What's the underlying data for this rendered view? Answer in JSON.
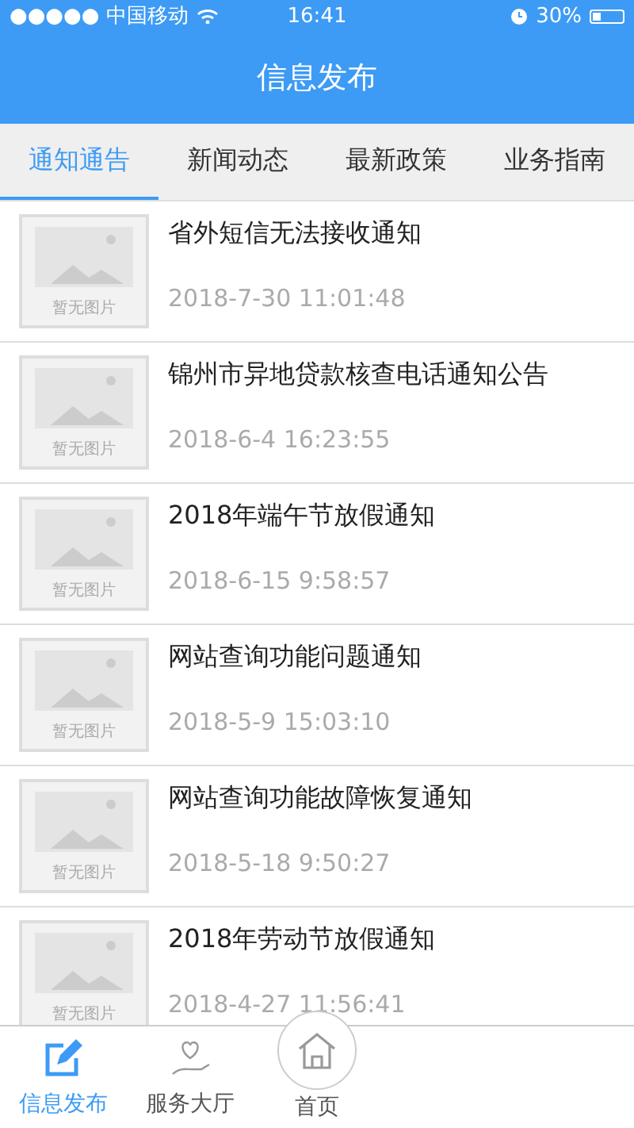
{
  "status_bar": {
    "carrier": "●●●●● 中国移动",
    "time": "16:41",
    "battery": "30%"
  },
  "header": {
    "title": "信息发布"
  },
  "tabs": [
    {
      "label": "通知通告",
      "selected": true
    },
    {
      "label": "新闻动态",
      "selected": false
    },
    {
      "label": "最新政策",
      "selected": false
    },
    {
      "label": "业务指南",
      "selected": false
    }
  ],
  "items": [
    {
      "title": "省外短信无法接收通知",
      "date": "2018-7-30 11:01:48",
      "image_caption": "暂无图片"
    },
    {
      "title": "锦州市异地贷款核查电话通知公告",
      "date": "2018-6-4 16:23:55",
      "image_caption": "暂无图片"
    },
    {
      "title": "2018年端午节放假通知",
      "date": "2018-6-15 9:58:57",
      "image_caption": "暂无图片"
    },
    {
      "title": "网站查询功能问题通知",
      "date": "2018-5-9 15:03:10",
      "image_caption": "暂无图片"
    },
    {
      "title": "网站查询功能故障恢复通知",
      "date": "2018-5-18 9:50:27",
      "image_caption": "暂无图片"
    },
    {
      "title": "2018年劳动节放假通知",
      "date": "2018-4-27 11:56:41",
      "image_caption": "暂无图片"
    }
  ],
  "bottom_nav": [
    {
      "label": "信息发布",
      "kind": "edit",
      "selected": true
    },
    {
      "label": "服务大厅",
      "kind": "hand",
      "selected": false
    },
    {
      "label": "首页",
      "kind": "home",
      "selected": false
    }
  ]
}
